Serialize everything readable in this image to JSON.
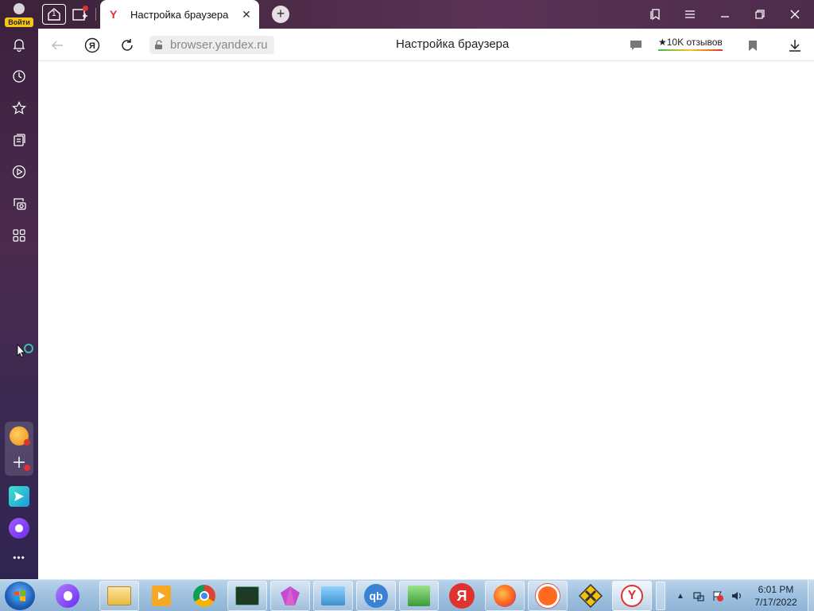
{
  "window": {
    "profile_login_label": "Войти",
    "home_tab_count": "1",
    "tab": {
      "title": "Настройка браузера",
      "favicon": "Y"
    }
  },
  "toolbar": {
    "url_host": "browser.yandex.ru",
    "page_title": "Настройка браузера",
    "reviews_label": "★10K отзывов"
  },
  "sidebar": {
    "icons": [
      "bell-icon",
      "history-icon",
      "star-icon",
      "collections-icon",
      "video-icon",
      "screenshot-icon",
      "apps-grid-icon"
    ],
    "more_label": "•••"
  },
  "taskbar": {
    "items": [
      "alice",
      "file-explorer",
      "media-player",
      "chrome",
      "terminal",
      "gem-app",
      "control-panel",
      "qbittorrent",
      "network-app",
      "yandex",
      "firefox",
      "uploader",
      "tools-app",
      "yandex-browser"
    ],
    "qbittorrent_label": "qb",
    "yandex_label": "Я",
    "clock": {
      "time": "6:01 PM",
      "date": "7/17/2022"
    }
  },
  "colors": {
    "accent_red": "#e0322e",
    "login_yellow": "#f6c619",
    "titlebar": "#4a2a45"
  }
}
